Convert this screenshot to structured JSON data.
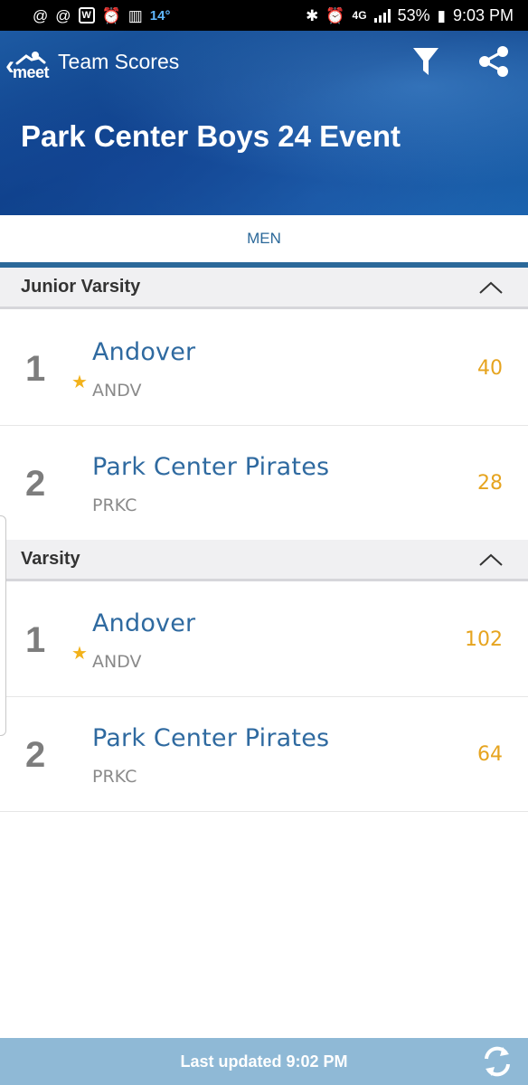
{
  "status_bar": {
    "temperature": "14°",
    "network": "4G",
    "battery": "53%",
    "time": "9:03 PM"
  },
  "header": {
    "logo_text": "meet",
    "title": "Team Scores",
    "event_title": "Park Center Boys 24 Event"
  },
  "tabs": [
    {
      "label": "MEN",
      "selected": true
    }
  ],
  "sections": [
    {
      "title": "Junior Varsity",
      "rows": [
        {
          "rank": "1",
          "team": "Andover",
          "code": "ANDV",
          "score": "40",
          "starred": true
        },
        {
          "rank": "2",
          "team": "Park Center Pirates",
          "code": "PRKC",
          "score": "28",
          "starred": false
        }
      ]
    },
    {
      "title": "Varsity",
      "rows": [
        {
          "rank": "1",
          "team": "Andover",
          "code": "ANDV",
          "score": "102",
          "starred": true
        },
        {
          "rank": "2",
          "team": "Park Center Pirates",
          "code": "PRKC",
          "score": "64",
          "starred": false
        }
      ]
    }
  ],
  "footer": {
    "last_updated": "Last updated 9:02 PM"
  },
  "colors": {
    "accent": "#2b6899",
    "score": "#e6a41f",
    "star": "#f2b21b",
    "footer": "#8fb9d6"
  }
}
